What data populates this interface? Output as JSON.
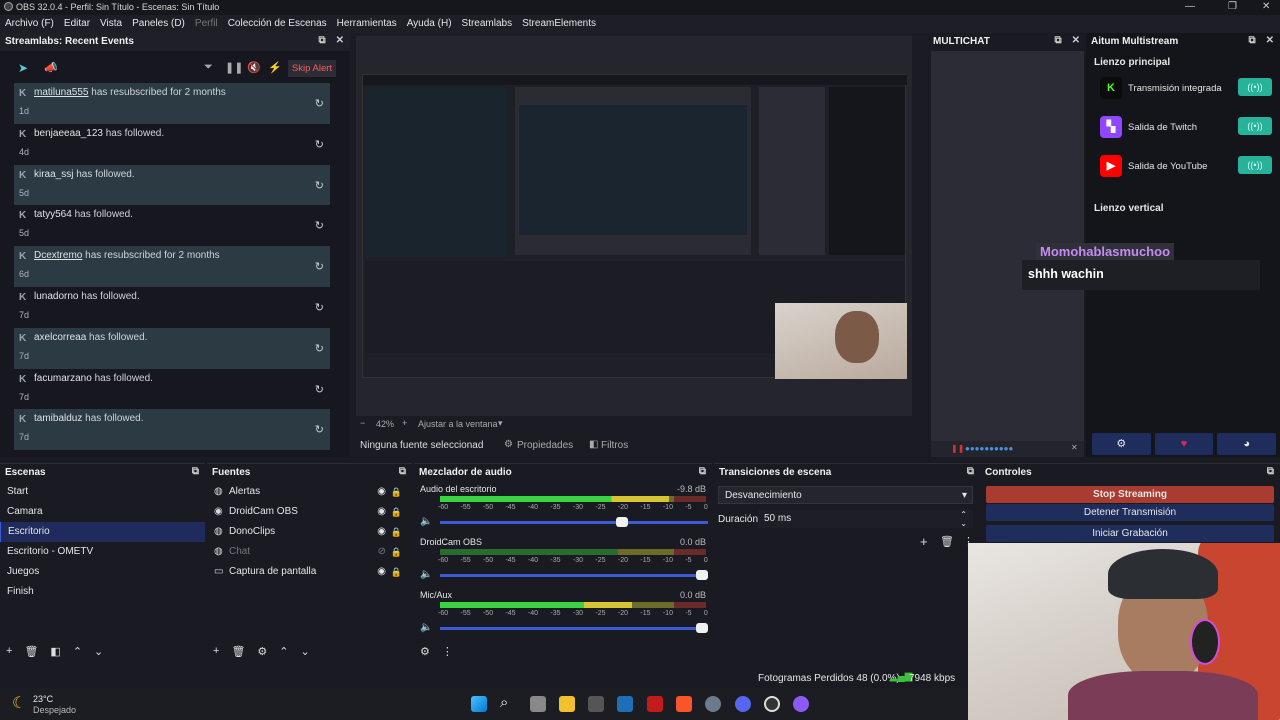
{
  "window": {
    "title": "OBS 32.0.4 - Perfil: Sin Título - Escenas: Sin Título",
    "controls": [
      "—",
      "❐",
      "✕"
    ]
  },
  "menu": {
    "items": [
      "Archivo (F)",
      "Editar",
      "Vista",
      "Paneles (D)",
      "Perfil",
      "Colección de Escenas",
      "Herramientas",
      "Ayuda (H)",
      "Streamlabs",
      "StreamElements"
    ]
  },
  "events_dock": {
    "title": "Streamlabs: Recent Events",
    "skip_alert": "Skip Alert",
    "events": [
      {
        "user": "matiluna555",
        "action": "has resubscribed for 2 months",
        "age": "1d",
        "link": true
      },
      {
        "user": "benjaeeaa_123",
        "action": "has followed.",
        "age": "4d",
        "link": false
      },
      {
        "user": "kiraa_ssj",
        "action": "has followed.",
        "age": "5d",
        "link": false
      },
      {
        "user": "tatyy564",
        "action": "has followed.",
        "age": "5d",
        "link": false
      },
      {
        "user": "Dcextremo",
        "action": "has resubscribed for 2 months",
        "age": "6d",
        "link": true
      },
      {
        "user": "lunadorno",
        "action": "has followed.",
        "age": "7d",
        "link": false
      },
      {
        "user": "axelcorreaa",
        "action": "has followed.",
        "age": "7d",
        "link": false
      },
      {
        "user": "facumarzano",
        "action": "has followed.",
        "age": "7d",
        "link": false
      },
      {
        "user": "tamibalduz",
        "action": "has followed.",
        "age": "7d",
        "link": false
      }
    ]
  },
  "preview": {
    "zoom": "42%",
    "fit": "Ajustar a la ventana",
    "no_source": "Ninguna fuente seleccionad",
    "properties": "Propiedades",
    "filters": "Filtros"
  },
  "multichat": {
    "title": "MULTICHAT"
  },
  "aitum": {
    "title": "Aitum Multistream",
    "main_canvas": "Lienzo principal",
    "vertical_canvas": "Lienzo vertical",
    "outputs": [
      {
        "label": "Transmisión integrada",
        "icon": "kick-icon",
        "color": "#0b0b0b"
      },
      {
        "label": "Salida de Twitch",
        "icon": "twitch-icon",
        "color": "#9146ff"
      },
      {
        "label": "Salida de YouTube",
        "icon": "youtube-icon",
        "color": "#ff0000"
      }
    ],
    "toggle_glyph": "((•))"
  },
  "chat_overlay": {
    "user": "Momohablasmuchoo",
    "message": "shhh wachin"
  },
  "scenes": {
    "title": "Escenas",
    "items": [
      "Start",
      "Camara",
      "Escritorio",
      "Escritorio - OMETV",
      "Juegos",
      "Finish"
    ],
    "selected_index": 2
  },
  "sources": {
    "title": "Fuentes",
    "items": [
      {
        "label": "Alertas",
        "icon": "browser-icon",
        "visible": true
      },
      {
        "label": "DroidCam OBS",
        "icon": "camera-icon",
        "visible": true
      },
      {
        "label": "DonoClips",
        "icon": "browser-icon",
        "visible": true
      },
      {
        "label": "Chat",
        "icon": "browser-icon",
        "visible": false
      },
      {
        "label": "Captura de pantalla",
        "icon": "monitor-icon",
        "visible": true
      }
    ]
  },
  "mixer": {
    "title": "Mezclador de audio",
    "ticks": [
      "-60",
      "-55",
      "-50",
      "-45",
      "-40",
      "-35",
      "-30",
      "-25",
      "-20",
      "-15",
      "-10",
      "-5",
      "0"
    ],
    "channels": [
      {
        "name": "Audio del escritorio",
        "db": "-9.8 dB",
        "level": 0.86,
        "volume": 0.7,
        "muted": false
      },
      {
        "name": "DroidCam OBS",
        "db": "0.0 dB",
        "level": 0.0,
        "volume": 1.0,
        "muted": true
      },
      {
        "name": "Mic/Aux",
        "db": "0.0 dB",
        "level": 0.72,
        "volume": 1.0,
        "muted": false
      }
    ]
  },
  "transitions": {
    "title": "Transiciones de escena",
    "selected": "Desvanecimiento",
    "duration_label": "Duración",
    "duration": "50 ms"
  },
  "controls": {
    "title": "Controles",
    "buttons": [
      "Stop Streaming",
      "Detener Transmisión",
      "Iniciar Grabación"
    ]
  },
  "status": {
    "dropped": "Fotogramas Perdidos 48 (0.0%)",
    "bitrate": "7948 kbps"
  },
  "weather": {
    "temp": "23°C",
    "desc": "Despejado"
  },
  "colors": {
    "accent": "#3c5bd5",
    "stop_stream": "#c0392b",
    "toggle": "#27b39a",
    "chat_user": "#c58cf5"
  }
}
